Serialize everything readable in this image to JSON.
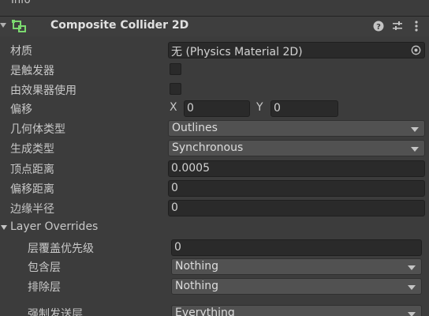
{
  "top_strip": {
    "text": "Info"
  },
  "component": {
    "title": "Composite Collider 2D",
    "icons": [
      "foldout-arrow-icon",
      "composite-collider-icon",
      "help-icon",
      "preset-icon",
      "more-icon"
    ]
  },
  "fields": {
    "material": {
      "label": "材质",
      "value": "无 (Physics Material 2D)"
    },
    "is_trigger": {
      "label": "是触发器"
    },
    "used_by_effector": {
      "label": "由效果器使用"
    },
    "offset": {
      "label": "偏移",
      "x_label": "X",
      "x_value": "0",
      "y_label": "Y",
      "y_value": "0"
    },
    "geometry_type": {
      "label": "几何体类型",
      "value": "Outlines"
    },
    "generation_type": {
      "label": "生成类型",
      "value": "Synchronous"
    },
    "vertex_distance": {
      "label": "顶点距离",
      "value": "0.0005"
    },
    "offset_distance": {
      "label": "偏移距离",
      "value": "0"
    },
    "edge_radius": {
      "label": "边缘半径",
      "value": "0"
    }
  },
  "layer_overrides": {
    "label": "Layer Overrides",
    "priority": {
      "label": "层覆盖优先级",
      "value": "0"
    },
    "include": {
      "label": "包含层",
      "value": "Nothing"
    },
    "exclude": {
      "label": "排除层",
      "value": "Nothing"
    },
    "force_send": {
      "label": "强制发送层",
      "value": "Everything"
    }
  }
}
